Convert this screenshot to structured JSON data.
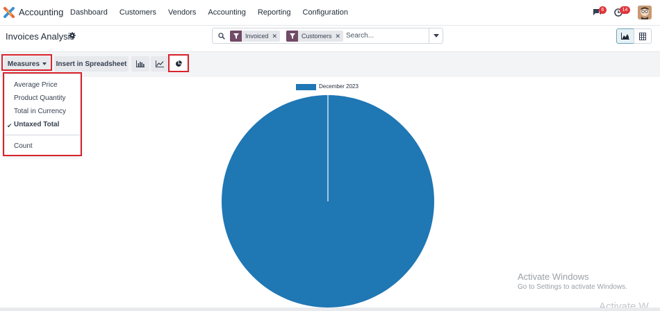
{
  "app": {
    "name": "Accounting"
  },
  "menu": [
    "Dashboard",
    "Customers",
    "Vendors",
    "Accounting",
    "Reporting",
    "Configuration"
  ],
  "systray": {
    "messages_count": "6",
    "activities_count": "14"
  },
  "page": {
    "title": "Invoices Analysis"
  },
  "search": {
    "facets": [
      {
        "label": "Invoiced"
      },
      {
        "label": "Customers"
      }
    ],
    "placeholder": "Search..."
  },
  "toolbar": {
    "measures_label": "Measures",
    "spreadsheet_label": "Insert in Spreadsheet"
  },
  "measures_menu": {
    "items": [
      "Average Price",
      "Product Quantity",
      "Total in Currency",
      "Untaxed Total"
    ],
    "selected": "Untaxed Total",
    "count_label": "Count"
  },
  "chart_data": {
    "type": "pie",
    "labels": [
      "December 2023"
    ],
    "values": [
      100
    ],
    "colors": [
      "#1f77b4"
    ],
    "legend_position": "top"
  },
  "watermark": {
    "line1": "Activate Windows",
    "line2": "Go to Settings to activate Windows.",
    "line3": "Activate W"
  },
  "colors": {
    "brand": "#714b67",
    "highlight": "#d9232d",
    "slice": "#1f77b4"
  }
}
